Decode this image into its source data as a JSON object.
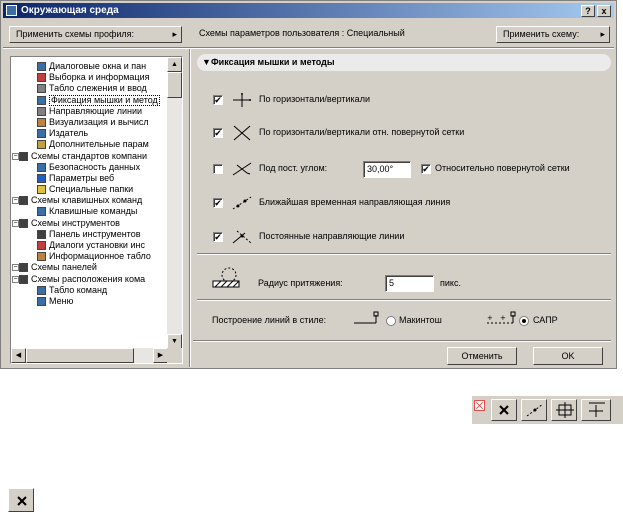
{
  "window": {
    "title": "Окружающая среда",
    "title_buttons": [
      "?",
      "x"
    ]
  },
  "top": {
    "apply_profile_label": "Применить схемы профиля:",
    "user_schemes_label": "Схемы параметров пользователя : Специальный",
    "apply_scheme_label": "Применить схему:"
  },
  "tree": {
    "items": [
      {
        "label": "Диалоговые окна и пан",
        "icon": "dialog-icon",
        "color": "#3a6ea5"
      },
      {
        "label": "Выборка и информация",
        "icon": "selection-icon",
        "color": "#c04040"
      },
      {
        "label": "Табло слежения и ввод",
        "icon": "tracker-icon",
        "color": "#808080"
      },
      {
        "label": "Фиксация мышки и метод",
        "icon": "snap-icon",
        "color": "#3a6ea5",
        "selected": true
      },
      {
        "label": "Направляющие линии",
        "icon": "guide-lines-icon",
        "color": "#808080"
      },
      {
        "label": "Визуализация и вычисл",
        "icon": "render-icon",
        "color": "#c08040"
      },
      {
        "label": "Издатель",
        "icon": "publisher-icon",
        "color": "#3a6ea5"
      },
      {
        "label": "Дополнительные парам",
        "icon": "extra-params-icon",
        "color": "#c0a040"
      },
      {
        "label": "Схемы стандартов компани",
        "icon": "folder-icon",
        "color": "#404040",
        "group": true
      },
      {
        "label": "Безопасность данных",
        "icon": "security-icon",
        "color": "#3a6ea5"
      },
      {
        "label": "Параметры веб",
        "icon": "web-icon",
        "color": "#2060c0"
      },
      {
        "label": "Специальные папки",
        "icon": "special-folder-icon",
        "color": "#e0c040"
      },
      {
        "label": "Схемы клавишных команд",
        "icon": "folder-icon",
        "color": "#404040",
        "group": true
      },
      {
        "label": "Клавишные команды",
        "icon": "keyboard-icon",
        "color": "#3a6ea5"
      },
      {
        "label": "Схемы инструментов",
        "icon": "folder-icon",
        "color": "#404040",
        "group": true
      },
      {
        "label": "Панель инструментов",
        "icon": "toolbar-icon",
        "color": "#404040"
      },
      {
        "label": "Диалоги установки инс",
        "icon": "tool-dialog-icon",
        "color": "#c04040"
      },
      {
        "label": "Информационное табло",
        "icon": "info-box-icon",
        "color": "#c08040"
      },
      {
        "label": "Схемы панелей",
        "icon": "folder-icon",
        "color": "#404040",
        "group": true
      },
      {
        "label": "Схемы расположения кома",
        "icon": "folder-icon",
        "color": "#404040",
        "group": true
      },
      {
        "label": "Табло команд",
        "icon": "command-box-icon",
        "color": "#3a6ea5"
      },
      {
        "label": "Меню",
        "icon": "menu-icon",
        "color": "#3a6ea5"
      }
    ]
  },
  "panel": {
    "section_title": "Фиксация мышки и методы",
    "options": [
      {
        "label": "По горизонтали/вертикали",
        "checked": true,
        "icon": "axis-cross-icon"
      },
      {
        "label": "По горизонтали/вертикали отн. повернутой сетки",
        "checked": true,
        "icon": "diagonal-cross-icon"
      },
      {
        "label": "Под пост. углом:",
        "checked": false,
        "icon": "angle-icon"
      },
      {
        "label": "Ближайшая временная направляющая линия",
        "checked": true,
        "icon": "temp-guide-icon"
      },
      {
        "label": "Постоянные направляющие линии",
        "checked": true,
        "icon": "permanent-guide-icon"
      }
    ],
    "angle_value": "30,00°",
    "relative_grid_label": "Относительно повернутой сетки",
    "relative_grid_checked": true,
    "snap_radius_label": "Радиус притяжения:",
    "snap_radius_value": "5",
    "snap_radius_unit": "пикс.",
    "line_style_label": "Построение линий в стиле:",
    "style_mac_label": "Макинтош",
    "style_cad_label": "САПР",
    "selected_style": "САПР"
  },
  "footer": {
    "cancel_label": "Отменить",
    "ok_label": "OK"
  }
}
